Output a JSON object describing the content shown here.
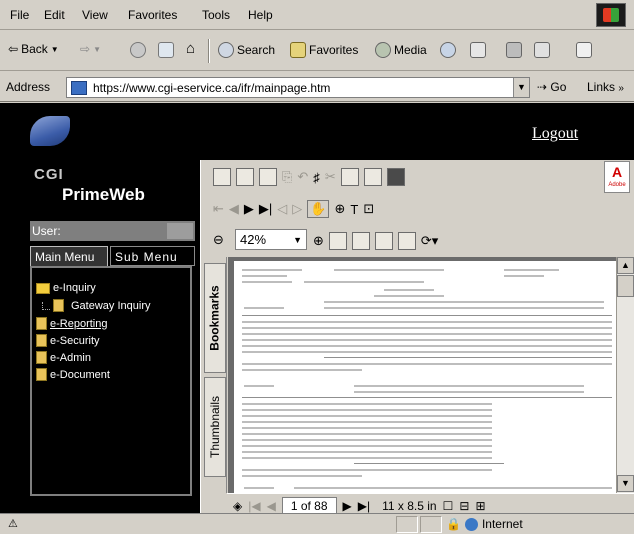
{
  "menubar": {
    "items": [
      "File",
      "Edit",
      "View",
      "Favorites",
      "Tools",
      "Help"
    ]
  },
  "toolbar": {
    "back_label": "Back",
    "search_label": "Search",
    "favorites_label": "Favorites",
    "media_label": "Media"
  },
  "address": {
    "label": "Address",
    "url": "https://www.cgi-eservice.ca/ifr/mainpage.htm",
    "go_label": "Go",
    "links_label": "Links"
  },
  "portal": {
    "logo_text": "CGI",
    "brand": "PrimeWeb",
    "logout": "Logout",
    "user_label": "User:",
    "tab_main": "Main Menu",
    "tab_sub": "Sub Menu",
    "menu": {
      "inquiry": "e-Inquiry",
      "gateway": "Gateway Inquiry",
      "reporting": "e-Reporting",
      "security": "e-Security",
      "admin": "e-Admin",
      "document": "e-Document"
    }
  },
  "viewer": {
    "zoom": "42%",
    "bookmarks_tab": "Bookmarks",
    "thumbnails_tab": "Thumbnails",
    "page_indicator": "1 of 88",
    "page_size": "11 x 8.5 in",
    "adobe_label": "Adobe"
  },
  "statusbar": {
    "zone": "Internet"
  },
  "colors": {
    "chrome": "#d4d0c8",
    "portal_bg": "#000000",
    "folder": "#f3cd3d",
    "adobe_red": "#d10000"
  }
}
